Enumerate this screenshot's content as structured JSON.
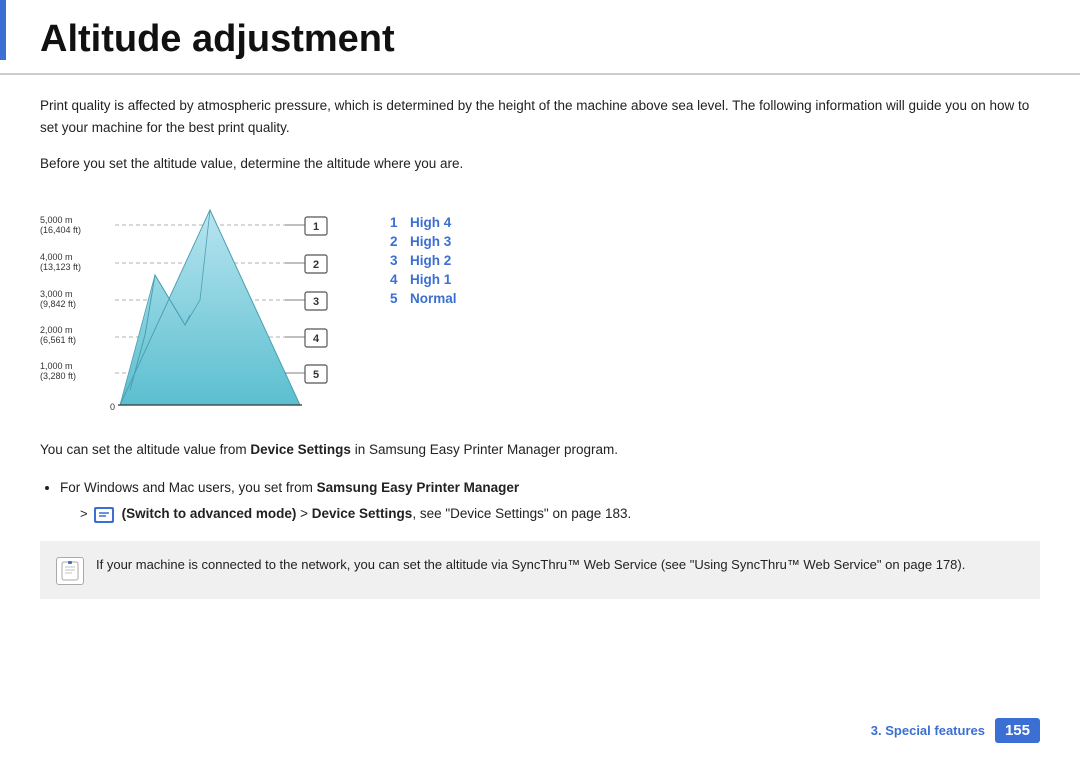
{
  "page": {
    "title": "Altitude adjustment",
    "blue_bar": true
  },
  "content": {
    "intro": "Print quality is affected by atmospheric pressure, which is determined by the height of the machine above sea level. The following information will guide you on how to set your machine for the best print quality.",
    "before_text": "Before you set the altitude value, determine the altitude where you are.",
    "diagram": {
      "labels": {
        "5000m": "5,000 m",
        "5000ft": "(16,404 ft)",
        "4000m": "4,000 m",
        "4000ft": "(13,123 ft)",
        "3000m": "3,000 m",
        "3000ft": "(9,842 ft)",
        "2000m": "2,000 m",
        "2000ft": "(6,561 ft)",
        "1000m": "1,000 m",
        "1000ft": "(3,280 ft)",
        "zero": "0"
      },
      "boxes": [
        "1",
        "2",
        "3",
        "4",
        "5"
      ]
    },
    "legend": [
      {
        "number": "1",
        "label": "High 4"
      },
      {
        "number": "2",
        "label": "High 3"
      },
      {
        "number": "3",
        "label": "High 2"
      },
      {
        "number": "4",
        "label": "High 1"
      },
      {
        "number": "5",
        "label": "Normal"
      }
    ],
    "body1": "You can set the altitude value from Device Settings in Samsung Easy Printer Manager program.",
    "body1_bold": "Device Settings",
    "bullet1_prefix": "For Windows and Mac users, you set from ",
    "bullet1_bold": "Samsung Easy Printer Manager",
    "sub_arrow": ">",
    "sub_icon_label": "(Switch to advanced mode)",
    "sub_bold": "Device Settings",
    "sub_suffix": ", see \"Device Settings\" on page 183.",
    "note_text": "If your machine is connected to the network, you can set the altitude via SyncThru™ Web Service (see \"Using SyncThru™ Web Service\" on page 178)."
  },
  "footer": {
    "chapter": "3.  Special features",
    "page": "155"
  }
}
